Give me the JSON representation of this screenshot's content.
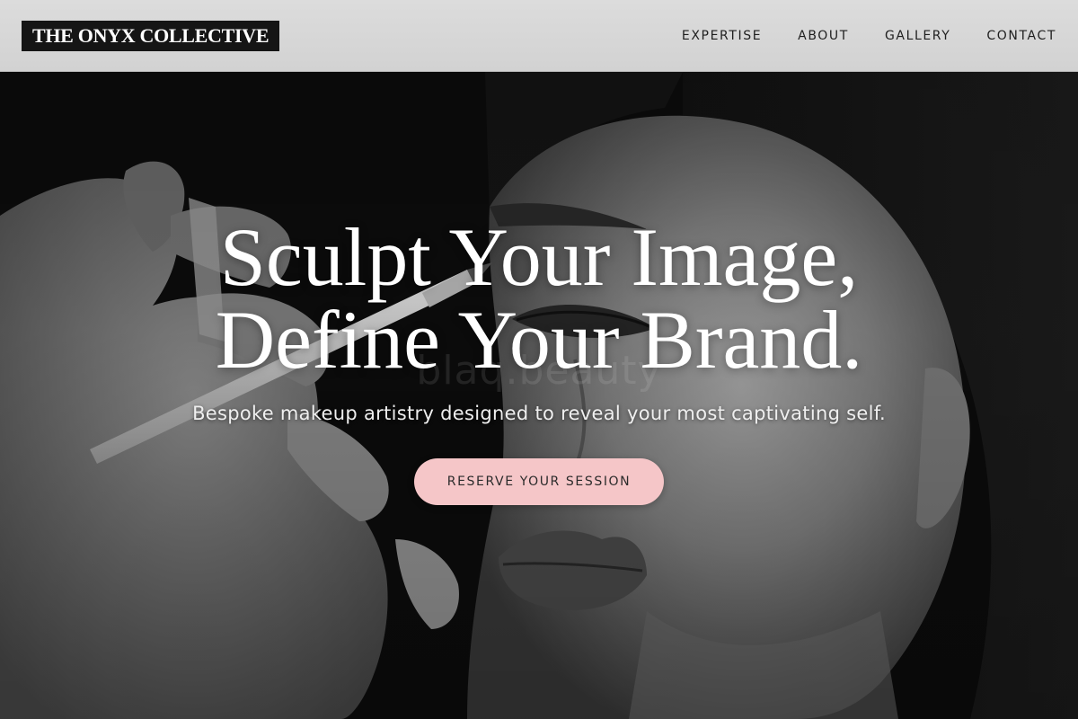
{
  "brand": {
    "logo_text": "THE ONYX COLLECTIVE"
  },
  "nav": {
    "items": [
      {
        "label": "EXPERTISE"
      },
      {
        "label": "ABOUT"
      },
      {
        "label": "GALLERY"
      },
      {
        "label": "CONTACT"
      }
    ]
  },
  "hero": {
    "title_line1": "Sculpt Your Image,",
    "title_line2": "Define Your Brand.",
    "subtitle": "Bespoke makeup artistry designed to reveal your most captivating self.",
    "cta_label": "RESERVE YOUR SESSION",
    "watermark_text": "blaq.beauty"
  },
  "colors": {
    "header_bg": "#d7d7d7",
    "logo_bg": "#151515",
    "cta_bg": "#f5c6c8",
    "hero_text": "#ffffff"
  }
}
